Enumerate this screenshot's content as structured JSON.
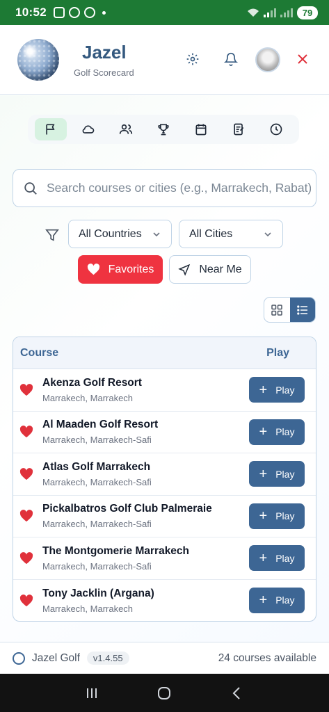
{
  "status_bar": {
    "time": "10:52",
    "battery": "79"
  },
  "header": {
    "title": "Jazel",
    "subtitle": "Golf Scorecard"
  },
  "tabs": [
    {
      "icon": "flag-icon",
      "active": true
    },
    {
      "icon": "cloud-icon",
      "active": false
    },
    {
      "icon": "users-icon",
      "active": false
    },
    {
      "icon": "trophy-icon",
      "active": false
    },
    {
      "icon": "calendar-icon",
      "active": false
    },
    {
      "icon": "notes-icon",
      "active": false
    },
    {
      "icon": "clock-icon",
      "active": false
    }
  ],
  "search": {
    "placeholder": "Search courses or cities (e.g., Marrakech, Rabat)"
  },
  "filters": {
    "country": "All Countries",
    "city": "All Cities"
  },
  "buttons": {
    "favorites": "Favorites",
    "near_me": "Near Me"
  },
  "table": {
    "col_course": "Course",
    "col_play": "Play",
    "play_label": "Play",
    "rows": [
      {
        "name": "Akenza Golf Resort",
        "location": "Marrakech, Marrakech",
        "favorite": true
      },
      {
        "name": "Al Maaden Golf Resort",
        "location": "Marrakech, Marrakech-Safi",
        "favorite": true
      },
      {
        "name": "Atlas Golf Marrakech",
        "location": "Marrakech, Marrakech-Safi",
        "favorite": true
      },
      {
        "name": "Pickalbatros Golf Club Palmeraie",
        "location": "Marrakech, Marrakech-Safi",
        "favorite": true
      },
      {
        "name": "The Montgomerie Marrakech",
        "location": "Marrakech, Marrakech-Safi",
        "favorite": true
      },
      {
        "name": "Tony Jacklin (Argana)",
        "location": "Marrakech, Marrakech",
        "favorite": true
      }
    ]
  },
  "footer": {
    "app_name": "Jazel Golf",
    "version": "v1.4.55",
    "count_text": "24 courses available"
  },
  "colors": {
    "primary": "#3d6694",
    "accent_red": "#ef3340",
    "status_green": "#1d7a34",
    "tab_active": "#d7f2e1"
  }
}
